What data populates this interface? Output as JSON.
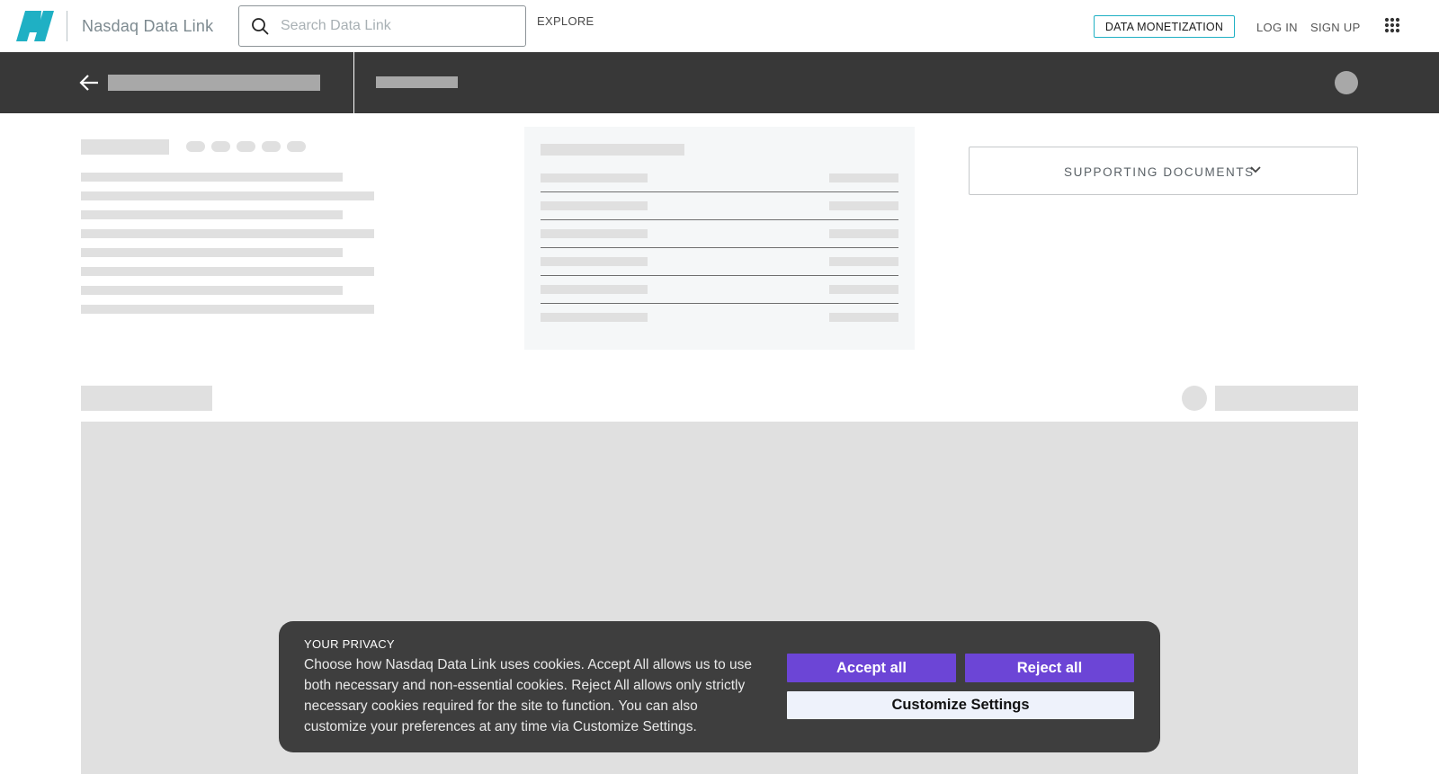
{
  "header": {
    "brand": "Nasdaq Data Link",
    "search_placeholder": "Search Data Link",
    "explore": "EXPLORE",
    "data_monetization": "DATA MONETIZATION",
    "login": "LOG IN",
    "signup": "SIGN UP"
  },
  "colors": {
    "brand_teal": "#1fb0c4",
    "dark_bar": "#383838",
    "skeleton": "#e0e0e0",
    "cookie_bg": "#3e3e3e",
    "button_purple": "#6c45d6"
  },
  "sidebar": {
    "supporting_documents": "SUPPORTING DOCUMENTS"
  },
  "cookie_banner": {
    "title": "YOUR PRIVACY",
    "text": "Choose how Nasdaq Data Link uses cookies. Accept All allows us to use both necessary and non-essential cookies. Reject All allows only strictly necessary cookies required for the site to function. You can also customize your preferences at any time via Customize Settings.",
    "accept_label": "Accept all",
    "reject_label": "Reject all",
    "customize_label": "Customize Settings"
  },
  "icons": [
    "logo-icon",
    "search-icon",
    "apps-grid-icon",
    "back-arrow-icon",
    "chevron-down-icon"
  ]
}
